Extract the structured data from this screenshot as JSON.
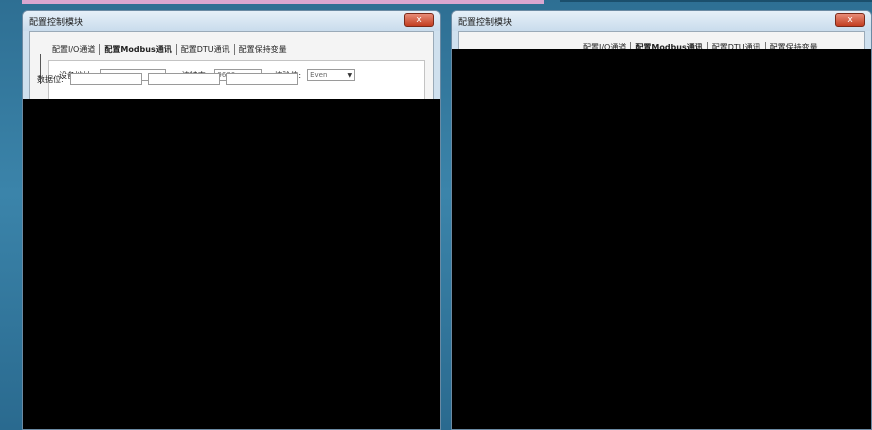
{
  "windows": [
    {
      "title": "配置控制模块",
      "close_label": "x",
      "tabs": [
        "配置I/O通道",
        "配置Modbus通讯",
        "配置DTU通讯",
        "配置保持变量"
      ],
      "row1": {
        "device_label": "设备地址:",
        "device_value": "",
        "baud_label": "波特率:",
        "baud_value": "9600",
        "parity_label": "校验位:",
        "parity_value": "Even"
      },
      "row2": {
        "label": "数据位:",
        "value1": "",
        "value2": "",
        "value3": ""
      }
    },
    {
      "title": "配置控制模块",
      "close_label": "x",
      "tabs": [
        "配置I/O通道",
        "配置Modbus通讯",
        "配置DTU通讯",
        "配置保持变量"
      ]
    }
  ]
}
